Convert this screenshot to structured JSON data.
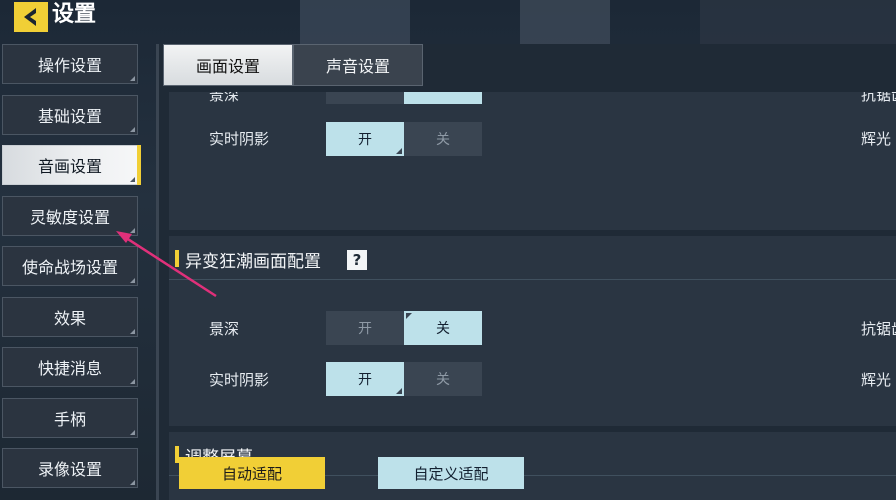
{
  "header": {
    "title": "设置"
  },
  "sidebar": {
    "items": [
      {
        "label": "操作设置"
      },
      {
        "label": "基础设置"
      },
      {
        "label": "音画设置"
      },
      {
        "label": "灵敏度设置"
      },
      {
        "label": "使命战场设置"
      },
      {
        "label": "效果"
      },
      {
        "label": "快捷消息"
      },
      {
        "label": "手柄"
      },
      {
        "label": "录像设置"
      }
    ],
    "active_index": 2
  },
  "tabs": [
    {
      "label": "画面设置",
      "active": true
    },
    {
      "label": "声音设置",
      "active": false
    }
  ],
  "top_section": {
    "partial_label": "景深",
    "partial_right": "抗锯齿",
    "rows": [
      {
        "label": "实时阴影",
        "on_label": "开",
        "off_label": "关",
        "value": "开",
        "right_label": "辉光"
      }
    ]
  },
  "mutation_section": {
    "title": "异变狂潮画面配置",
    "help": "?",
    "rows": [
      {
        "label": "景深",
        "on_label": "开",
        "off_label": "关",
        "value": "关",
        "right_label": "抗锯齿"
      },
      {
        "label": "实时阴影",
        "on_label": "开",
        "off_label": "关",
        "value": "开",
        "right_label": "辉光"
      }
    ]
  },
  "screen_section": {
    "title": "调整屏幕",
    "auto_label": "自动适配",
    "custom_label": "自定义适配"
  },
  "colors": {
    "accent": "#f1cf36",
    "toggle_on": "#bde1ea",
    "annotation_arrow": "#e0307a"
  }
}
